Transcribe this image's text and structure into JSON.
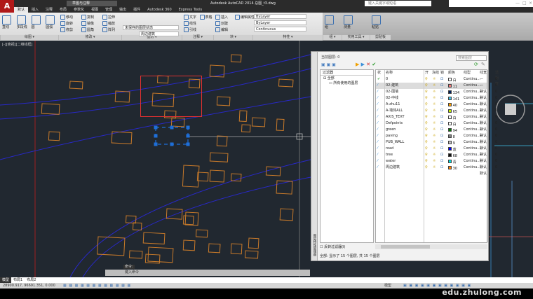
{
  "titlebar": {
    "workspace": "草图与注释",
    "title": "Autodesk AutoCAD 2014   总图_t3.dwg",
    "search_placeholder": "键入关键字或短语",
    "logo": "A"
  },
  "tabs": [
    "默认",
    "插入",
    "注释",
    "布局",
    "参数化",
    "视图",
    "管理",
    "输出",
    "插件",
    "Autodesk 360",
    "Express Tools"
  ],
  "ribbon": {
    "draw": {
      "label": "绘图 ▾",
      "items": [
        "直线",
        "多段线",
        "圆",
        "圆弧"
      ]
    },
    "modify": {
      "label": "修改 ▾",
      "items": [
        "移动",
        "旋转",
        "修剪",
        "复制",
        "镜像",
        "圆角",
        "拉伸",
        "缩放",
        "阵列"
      ]
    },
    "layers": {
      "label": "图层 ▾",
      "state": "未保存的图层状态",
      "current": "周边建筑"
    },
    "annotation": {
      "label": "注释 ▾",
      "items": [
        "文字",
        "线性",
        "引线",
        "表格"
      ]
    },
    "block": {
      "label": "块 ▾",
      "items": [
        "插入",
        "创建",
        "编辑",
        "编辑属性"
      ]
    },
    "properties": {
      "label": "特性 ▾",
      "color": "ByLayer",
      "lineweight": "ByLayer",
      "linetype": "Continuous"
    },
    "groups": {
      "label": "组 ▾",
      "items": [
        "组"
      ]
    },
    "utilities": {
      "label": "实用工具 ▾",
      "items": [
        "测量"
      ]
    },
    "clipboard": {
      "label": "剪贴板",
      "items": [
        "粘贴"
      ]
    }
  },
  "viewport_label": "[-][俯视][二维线框]",
  "layer_dialog": {
    "title": "当前图层: 0",
    "search_placeholder": "搜索图层",
    "tree": {
      "header": "过滤器",
      "root": "全部",
      "child": "所有使用的图层"
    },
    "columns": [
      "状",
      "名称",
      "开",
      "冻结",
      "锁",
      "颜色",
      "线型",
      "线宽",
      "透明度"
    ],
    "rows": [
      {
        "name": "0",
        "color_label": "白",
        "color": "#ffffff",
        "linetype": "Continu...",
        "lineweight": "默认",
        "transparency": "0",
        "current": true
      },
      {
        "name": "02-建筑",
        "color_label": "11",
        "color": "#f07a7a",
        "linetype": "Continu...",
        "lineweight": "默认",
        "transparency": "0",
        "selected": true
      },
      {
        "name": "02-围墙",
        "color_label": "134",
        "color": "#002060",
        "linetype": "Continu...",
        "lineweight": "默认",
        "transparency": "0"
      },
      {
        "name": "02-中线",
        "color_label": "141",
        "color": "#3fc0e8",
        "linetype": "Continu...",
        "lineweight": "默认",
        "transparency": "0"
      },
      {
        "name": "A-zhu11",
        "color_label": "40",
        "color": "#ffa000",
        "linetype": "Continu...",
        "lineweight": "默认",
        "transparency": "0"
      },
      {
        "name": "A-墙体ALL",
        "color_label": "65",
        "color": "#c0f000",
        "linetype": "Continu...",
        "lineweight": "默认",
        "transparency": "0"
      },
      {
        "name": "AXIS_TEXT",
        "color_label": "白",
        "color": "#ffffff",
        "linetype": "Continu...",
        "lineweight": "默认",
        "transparency": "0"
      },
      {
        "name": "Defpoints",
        "color_label": "白",
        "color": "#ffffff",
        "linetype": "Continu...",
        "lineweight": "默认",
        "transparency": "0"
      },
      {
        "name": "green",
        "color_label": "94",
        "color": "#008000",
        "linetype": "Continu...",
        "lineweight": "默认",
        "transparency": "0"
      },
      {
        "name": "paving",
        "color_label": "8",
        "color": "#808080",
        "linetype": "Continu...",
        "lineweight": "默认",
        "transparency": "0"
      },
      {
        "name": "PUB_WALL",
        "color_label": "9",
        "color": "#c0c0c0",
        "linetype": "Continu...",
        "lineweight": "默认",
        "transparency": "0"
      },
      {
        "name": "road",
        "color_label": "蓝",
        "color": "#0000ff",
        "linetype": "Continu...",
        "lineweight": "默认",
        "transparency": "0"
      },
      {
        "name": "tree",
        "color_label": "68",
        "color": "#101010",
        "linetype": "Continu...",
        "lineweight": "默认",
        "transparency": "0"
      },
      {
        "name": "water",
        "color_label": "青",
        "color": "#00e0e0",
        "linetype": "Continu...",
        "lineweight": "默认",
        "transparency": "0"
      },
      {
        "name": "周边建筑",
        "color_label": "30",
        "color": "#ff8000",
        "linetype": "Continu...",
        "lineweight": "默认",
        "transparency": "0"
      }
    ],
    "invert_filter": "反转过滤器(I)",
    "status": "全部: 显示了 15 个图层, 共 15 个图层",
    "side_label": "图层特性管理器"
  },
  "command": {
    "prompt": "键入命令",
    "tooltip": "命令:"
  },
  "layout_tabs": [
    "模型",
    "布局1",
    "布局2"
  ],
  "statusbar": {
    "coords": "28900.917, 96691.351, 0.000",
    "right": "模型"
  },
  "watermark": "edu.zhulong.com",
  "colors": {
    "background": "#212830",
    "building": "#c87a2a",
    "road": "#2828c8",
    "selection": "#e03030",
    "grip": "#1e6fd9"
  }
}
